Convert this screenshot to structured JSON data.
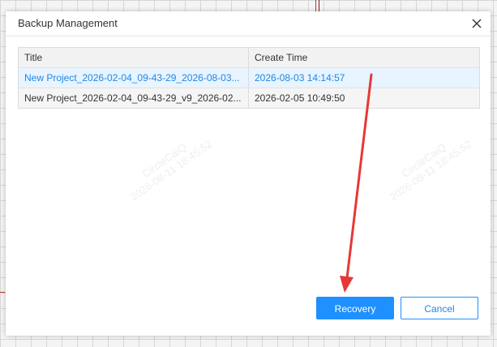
{
  "dialog": {
    "title": "Backup Management",
    "close_icon": "close-icon"
  },
  "table": {
    "headers": [
      "Title",
      "Create Time"
    ],
    "rows": [
      {
        "title": "New Project_2026-02-04_09-43-29_2026-08-03...",
        "create_time": "2026-08-03 14:14:57",
        "selected": true
      },
      {
        "title": "New Project_2026-02-04_09-43-29_v9_2026-02...",
        "create_time": "2026-02-05 10:49:50",
        "selected": false
      }
    ]
  },
  "watermark": {
    "line1": "CircleCaiQ",
    "line2": "2026-08-11 18:45:52"
  },
  "buttons": {
    "recovery_label": "Recovery",
    "cancel_label": "Cancel"
  },
  "colors": {
    "accent": "#1e90ff",
    "selected_text": "#1e88e5",
    "selected_row_bg": "#e8f4ff",
    "annotation_arrow": "#e53935"
  }
}
